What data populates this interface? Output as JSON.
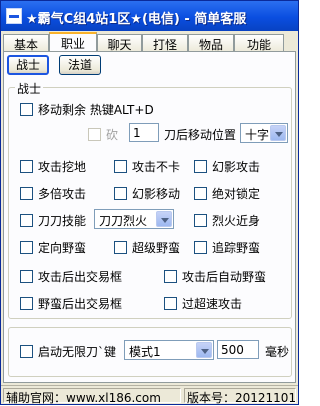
{
  "window": {
    "title": "★霸气C组4站1区★(电信) - 简单客服"
  },
  "tabs": [
    "基本",
    "职业",
    "聊天",
    "打怪",
    "物品",
    "功能"
  ],
  "active_tab": "职业",
  "subtabs": [
    "战士",
    "法道"
  ],
  "active_subtab": "战士",
  "warrior": {
    "group_label": "战士",
    "move_remain_label": "移动剩余 热键ALT+D",
    "chop_label": "砍",
    "chop_count": "1",
    "after_move_label": "刀后移动位置",
    "move_position": "十字",
    "options": {
      "attack_dig": "攻击挖地",
      "attack_no_stuck": "攻击不卡",
      "phantom_attack": "幻影攻击",
      "multi_attack": "多倍攻击",
      "phantom_move": "幻影移动",
      "absolute_lock": "绝对锁定",
      "blade_skill": "刀刀技能",
      "blade_skill_value": "刀刀烈火",
      "fire_close": "烈火近身",
      "fixed_pos_beast": "定向野蛮",
      "super_beast": "超级野蛮",
      "chase_beast": "追踪野蛮",
      "attack_trade_box": "攻击后出交易框",
      "attack_auto_beast": "攻击后自动野蛮",
      "beast_trade_box": "野蛮后出交易框",
      "super_speed_attack": "过超速攻击"
    }
  },
  "unlimited": {
    "label": "启动无限刀`键",
    "mode": "模式1",
    "ms_value": "500",
    "unit": "毫秒"
  },
  "status": {
    "website": "辅助官网：www.xl186.com",
    "version": "版本号：20121101"
  },
  "colors": {
    "titlebar": "#0a4ee0",
    "window_bg": "#ece9d8",
    "panel_bg": "#fcfcfe",
    "tab_active_accent": "#f9b22a"
  }
}
